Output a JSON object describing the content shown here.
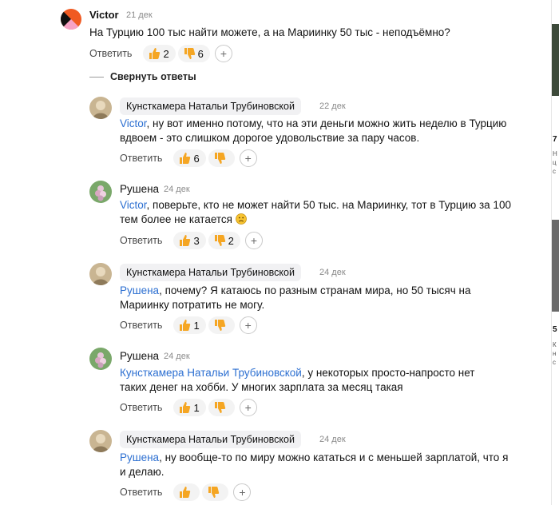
{
  "reply_label": "Ответить",
  "collapse_label": "Свернуть ответы",
  "comments": [
    {
      "author": "Victor",
      "date": "21 дек",
      "mention": "",
      "text": "На Турцию 100 тыс найти можете, а на Мариинку 50 тыс - неподъёмно?",
      "likes": "2",
      "dislikes": "6"
    },
    {
      "author": "Кунсткамера Натальи Трубиновской",
      "date": "22 дек",
      "mention": "Victor",
      "text": ", ну вот именно потому, что на эти деньги можно жить неделю в Турцию вдвоем - это слишком дорогое удовольствие за пару часов.",
      "likes": "6",
      "dislikes": ""
    },
    {
      "author": "Рушена",
      "date": "24 дек",
      "mention": "Victor",
      "text": ", поверьте, кто не может найти 50 тыс. на Мариинку, тот в Турцию за 100 тем более не катается",
      "likes": "3",
      "dislikes": "2"
    },
    {
      "author": "Кунсткамера Натальи Трубиновской",
      "date": "24 дек",
      "mention": "Рушена",
      "text": ", почему? Я катаюсь по разным странам мира, но 50 тысяч на Мариинку потратить не могу.",
      "likes": "1",
      "dislikes": ""
    },
    {
      "author": "Рушена",
      "date": "24 дек",
      "mention": "Кунсткамера Натальи Трубиновской",
      "text": ", у некоторых просто-напросто нет таких денег на хобби. У многих зарплата за месяц такая",
      "likes": "1",
      "dislikes": ""
    },
    {
      "author": "Кунсткамера Натальи Трубиновской",
      "date": "24 дек",
      "mention": "Рушена",
      "text": ", ну вообще-то по миру можно кататься и с меньшей зарплатой, что я и делаю.",
      "likes": "",
      "dislikes": ""
    }
  ],
  "sidebar": {
    "snippets": [
      "7",
      "Н",
      "ц",
      "с",
      "5",
      "К",
      "н",
      "с"
    ]
  }
}
